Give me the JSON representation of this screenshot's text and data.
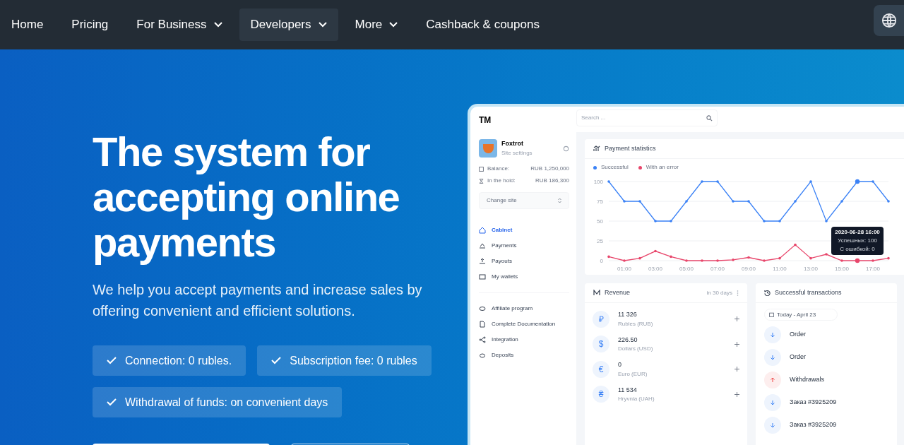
{
  "nav": {
    "items": [
      {
        "label": "Home",
        "dropdown": false,
        "selected": false
      },
      {
        "label": "Pricing",
        "dropdown": false,
        "selected": false
      },
      {
        "label": "For Business",
        "dropdown": true,
        "selected": false
      },
      {
        "label": "Developers",
        "dropdown": true,
        "selected": true
      },
      {
        "label": "More",
        "dropdown": true,
        "selected": false
      },
      {
        "label": "Cashback & coupons",
        "dropdown": false,
        "selected": false
      }
    ]
  },
  "hero": {
    "title": "The system for accepting online payments",
    "subtitle": "We help you accept payments and increase sales by offering convenient and efficient solutions.",
    "features": [
      {
        "label": "Connection: 0 rubles."
      },
      {
        "label": "Subscription fee: 0 rubles"
      },
      {
        "label": "Withdrawal of funds: on convenient days"
      }
    ],
    "buttons": [
      {
        "kind": "primary"
      },
      {
        "kind": "outline"
      }
    ]
  },
  "dashboard": {
    "logo": "TM",
    "search": {
      "placeholder": "Search ..."
    },
    "site": {
      "name": "Foxtrot",
      "caption": "Site settings"
    },
    "balances": [
      {
        "label": "Balance:",
        "value": "RUB 1,250,000"
      },
      {
        "label": "In the hold:",
        "value": "RUB 186,300"
      }
    ],
    "change_site": "Change site",
    "menu": [
      {
        "label": "Cabinet",
        "selected": true
      },
      {
        "label": "Payments",
        "selected": false
      },
      {
        "label": "Payouts",
        "selected": false
      },
      {
        "label": "My wallets",
        "selected": false
      }
    ],
    "menu_secondary": [
      {
        "label": "Affiliate program"
      },
      {
        "label": "Complete Documentation"
      },
      {
        "label": "Integration"
      },
      {
        "label": "Deposits"
      }
    ],
    "statistics": {
      "title": "Payment statistics",
      "chart_data": {
        "type": "line",
        "x": [
          0,
          1,
          2,
          3,
          4,
          5,
          6,
          7,
          8,
          9,
          10,
          11,
          12,
          13,
          14,
          15,
          16,
          17,
          18
        ],
        "xlim": [
          0,
          18
        ],
        "ylim": [
          0,
          100
        ],
        "grid": true,
        "xticks": [
          {
            "value": 1,
            "label": "01:00"
          },
          {
            "value": 3,
            "label": "03:00"
          },
          {
            "value": 5,
            "label": "05:00"
          },
          {
            "value": 7,
            "label": "07:00"
          },
          {
            "value": 9,
            "label": "09:00"
          },
          {
            "value": 11,
            "label": "11:00"
          },
          {
            "value": 13,
            "label": "13:00"
          },
          {
            "value": 15,
            "label": "15:00"
          },
          {
            "value": 17,
            "label": "17:00"
          }
        ],
        "yticks": [
          0,
          25,
          50,
          75,
          100
        ],
        "series": [
          {
            "name": "Successful",
            "color": "#3b82f6",
            "values": [
              100,
              75,
              75,
              50,
              50,
              75,
              100,
              100,
              75,
              75,
              50,
              50,
              75,
              100,
              50,
              75,
              100,
              100,
              75
            ]
          },
          {
            "name": "With an error",
            "color": "#e8466b",
            "values": [
              5,
              0,
              3,
              12,
              5,
              0,
              0,
              0,
              1,
              4,
              0,
              3,
              20,
              3,
              8,
              0,
              0,
              0,
              3
            ]
          }
        ]
      },
      "tooltip": {
        "date": "2020-06-28 16:00",
        "lines": [
          "Успешных: 100",
          "С ошибкой: 0"
        ]
      }
    },
    "revenue": {
      "title": "Revenue",
      "period": "in 30 days",
      "items": [
        {
          "symbol": "₽",
          "amount": "11 326",
          "currency": "Rubles (RUB)"
        },
        {
          "symbol": "$",
          "amount": "226.50",
          "currency": "Dollars (USD)"
        },
        {
          "symbol": "€",
          "amount": "0",
          "currency": "Euro (EUR)"
        },
        {
          "symbol": "₴",
          "amount": "11 534",
          "currency": "Hryvnia (UAH)"
        }
      ]
    },
    "transactions": {
      "title": "Successful transactions",
      "date": "Today - April 23",
      "items": [
        {
          "label": "Order",
          "kind": "in"
        },
        {
          "label": "Order",
          "kind": "in"
        },
        {
          "label": "Withdrawals",
          "kind": "out"
        },
        {
          "label": "Заказ #3925209",
          "kind": "in"
        },
        {
          "label": "Заказ #3925209",
          "kind": "in"
        }
      ]
    }
  }
}
